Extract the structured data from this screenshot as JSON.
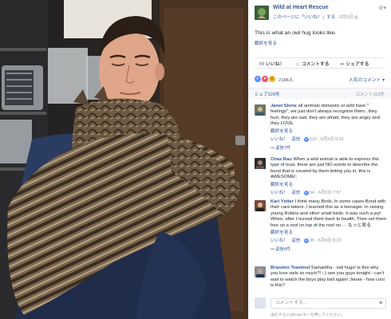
{
  "post": {
    "page_name": "Wild at Heart Rescue",
    "meta_like_text": "このページに「いいね！」する",
    "meta_date": "6月5日",
    "text": "This is what an owl hug looks like.",
    "translate": "翻訳を見る"
  },
  "actions": {
    "like": "いいね！",
    "comment": "コメントする",
    "share": "シェアする"
  },
  "reactions": {
    "count": "2184人",
    "order": "人気のコメント ▾"
  },
  "shares": {
    "shares_label": "シェア229件",
    "comments_count": "コメント113件"
  },
  "comments": [
    {
      "author": "Janet Stone",
      "text": "all animals domestic or wild have \" feelings\", we just don't always recognize them...they hurt, they are sad, they are afraid, they are angry and they LOVE.",
      "translate": "翻訳を見る",
      "meta_like": "いいね！",
      "meta_reply": "返信",
      "meta_likes": "122",
      "meta_date": "6月9日 5:23",
      "replies": "返信7件"
    },
    {
      "author": "Chas Rau",
      "text": "When a wild animal is able to express this type of trust, there are just NO words to describe the bond that is created by them letting you in. this is AWESOME!;",
      "translate": "翻訳を見る",
      "meta_like": "いいね！",
      "meta_reply": "返信",
      "meta_likes": "54",
      "meta_date": "6月9日 7:57",
      "replies": ""
    },
    {
      "author": "Kari Yetter",
      "text": "I think many Birds. In some cases Bond with their care takers. I learned this as a teenager. In raising young Robins and other small birds. It was such a joy! When, after I nursed them back to health. Then set them free on a roof on top of the roof on ··· もっと見る",
      "translate": "翻訳を見る",
      "meta_like": "いいね！",
      "meta_reply": "返信",
      "meta_likes": "35",
      "meta_date": "6月9日 8:23",
      "replies": "返信4件"
    },
    {
      "author": "Brandon Trammel",
      "text": "Samantha - owl hugs! is this why you love owls so much?! ;-) see you guys tonight - can't wait to watch the boys play ball again! Jenae - how cool is this?",
      "translate": "",
      "meta_like": "",
      "meta_reply": "",
      "meta_likes": "",
      "meta_date": "",
      "replies": ""
    }
  ],
  "compose": {
    "placeholder": "コメントする...",
    "hint": "送信するにはEnterキーを押してください。"
  },
  "icons": {
    "gear": "gear-icon",
    "camera": "camera-icon"
  },
  "colors": {
    "link": "#365899",
    "like_blue": "#5890ff",
    "love_red": "#f25268",
    "wow_yellow": "#f7b125"
  }
}
